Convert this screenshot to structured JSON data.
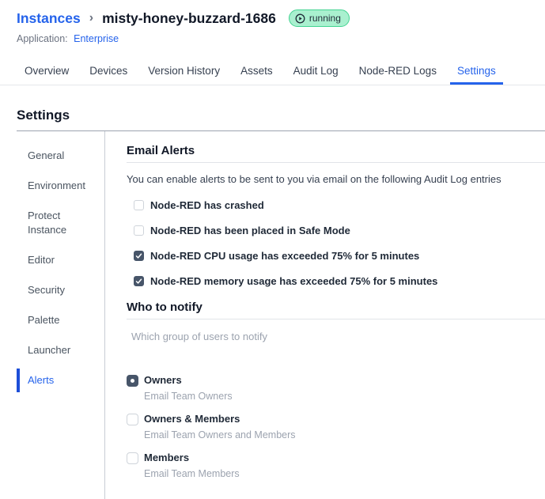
{
  "header": {
    "breadcrumb": "Instances",
    "separator": "›",
    "instance_name": "misty-honey-buzzard-1686",
    "status_badge": {
      "label": "running",
      "icon": "play-circle-icon"
    },
    "application_label": "Application:",
    "application_name": "Enterprise"
  },
  "tabs": [
    {
      "label": "Overview",
      "active": false
    },
    {
      "label": "Devices",
      "active": false
    },
    {
      "label": "Version History",
      "active": false
    },
    {
      "label": "Assets",
      "active": false
    },
    {
      "label": "Audit Log",
      "active": false
    },
    {
      "label": "Node-RED Logs",
      "active": false
    },
    {
      "label": "Settings",
      "active": true
    }
  ],
  "page": {
    "title": "Settings"
  },
  "sidebar": {
    "items": [
      {
        "label": "General",
        "active": false
      },
      {
        "label": "Environment",
        "active": false
      },
      {
        "label": "Protect Instance",
        "active": false
      },
      {
        "label": "Editor",
        "active": false
      },
      {
        "label": "Security",
        "active": false
      },
      {
        "label": "Palette",
        "active": false
      },
      {
        "label": "Launcher",
        "active": false
      },
      {
        "label": "Alerts",
        "active": true
      }
    ]
  },
  "email_alerts": {
    "title": "Email Alerts",
    "description": "You can enable alerts to be sent to you via email on the following Audit Log entries",
    "options": [
      {
        "label": "Node-RED has crashed",
        "checked": false
      },
      {
        "label": "Node-RED has been placed in Safe Mode",
        "checked": false
      },
      {
        "label": "Node-RED CPU usage has exceeded 75% for 5 minutes",
        "checked": true
      },
      {
        "label": "Node-RED memory usage has exceeded 75% for 5 minutes",
        "checked": true
      }
    ]
  },
  "who_to_notify": {
    "title": "Who to notify",
    "helper": "Which group of users to notify",
    "options": [
      {
        "label": "Owners",
        "description": "Email Team Owners",
        "selected": true
      },
      {
        "label": "Owners & Members",
        "description": "Email Team Owners and Members",
        "selected": false
      },
      {
        "label": "Members",
        "description": "Email Team Members",
        "selected": false
      }
    ]
  },
  "colors": {
    "accent_blue": "#2563eb",
    "active_bar_blue": "#1d4ed8",
    "badge_bg_green": "#a9f0cf",
    "badge_border_green": "#43d391",
    "checked_control": "#475569",
    "muted_text": "#9ca3af"
  }
}
